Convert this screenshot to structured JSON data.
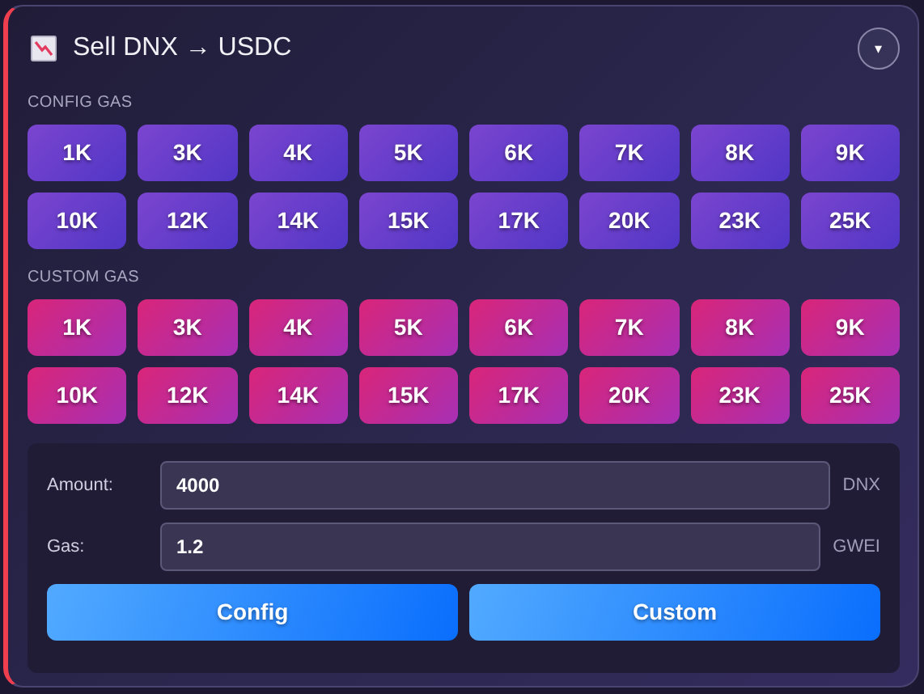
{
  "header": {
    "title": "Sell DNX → USDC",
    "menu_button": "▾"
  },
  "groups": [
    {
      "kind": "config",
      "label": "CONFIG GAS",
      "buttons": [
        "1K",
        "3K",
        "4K",
        "5K",
        "6K",
        "7K",
        "8K",
        "9K",
        "10K",
        "12K",
        "14K",
        "15K",
        "17K",
        "20K",
        "23K",
        "25K"
      ]
    },
    {
      "kind": "custom",
      "label": "CUSTOM GAS",
      "buttons": [
        "1K",
        "3K",
        "4K",
        "5K",
        "6K",
        "7K",
        "8K",
        "9K",
        "10K",
        "12K",
        "14K",
        "15K",
        "17K",
        "20K",
        "23K",
        "25K"
      ]
    }
  ],
  "form": {
    "fields": [
      {
        "label": "Amount:",
        "value": "4000",
        "unit": "DNX"
      },
      {
        "label": "Gas:",
        "value": "1.2",
        "unit": "GWEI"
      }
    ],
    "actions": [
      "Config",
      "Custom"
    ]
  }
}
